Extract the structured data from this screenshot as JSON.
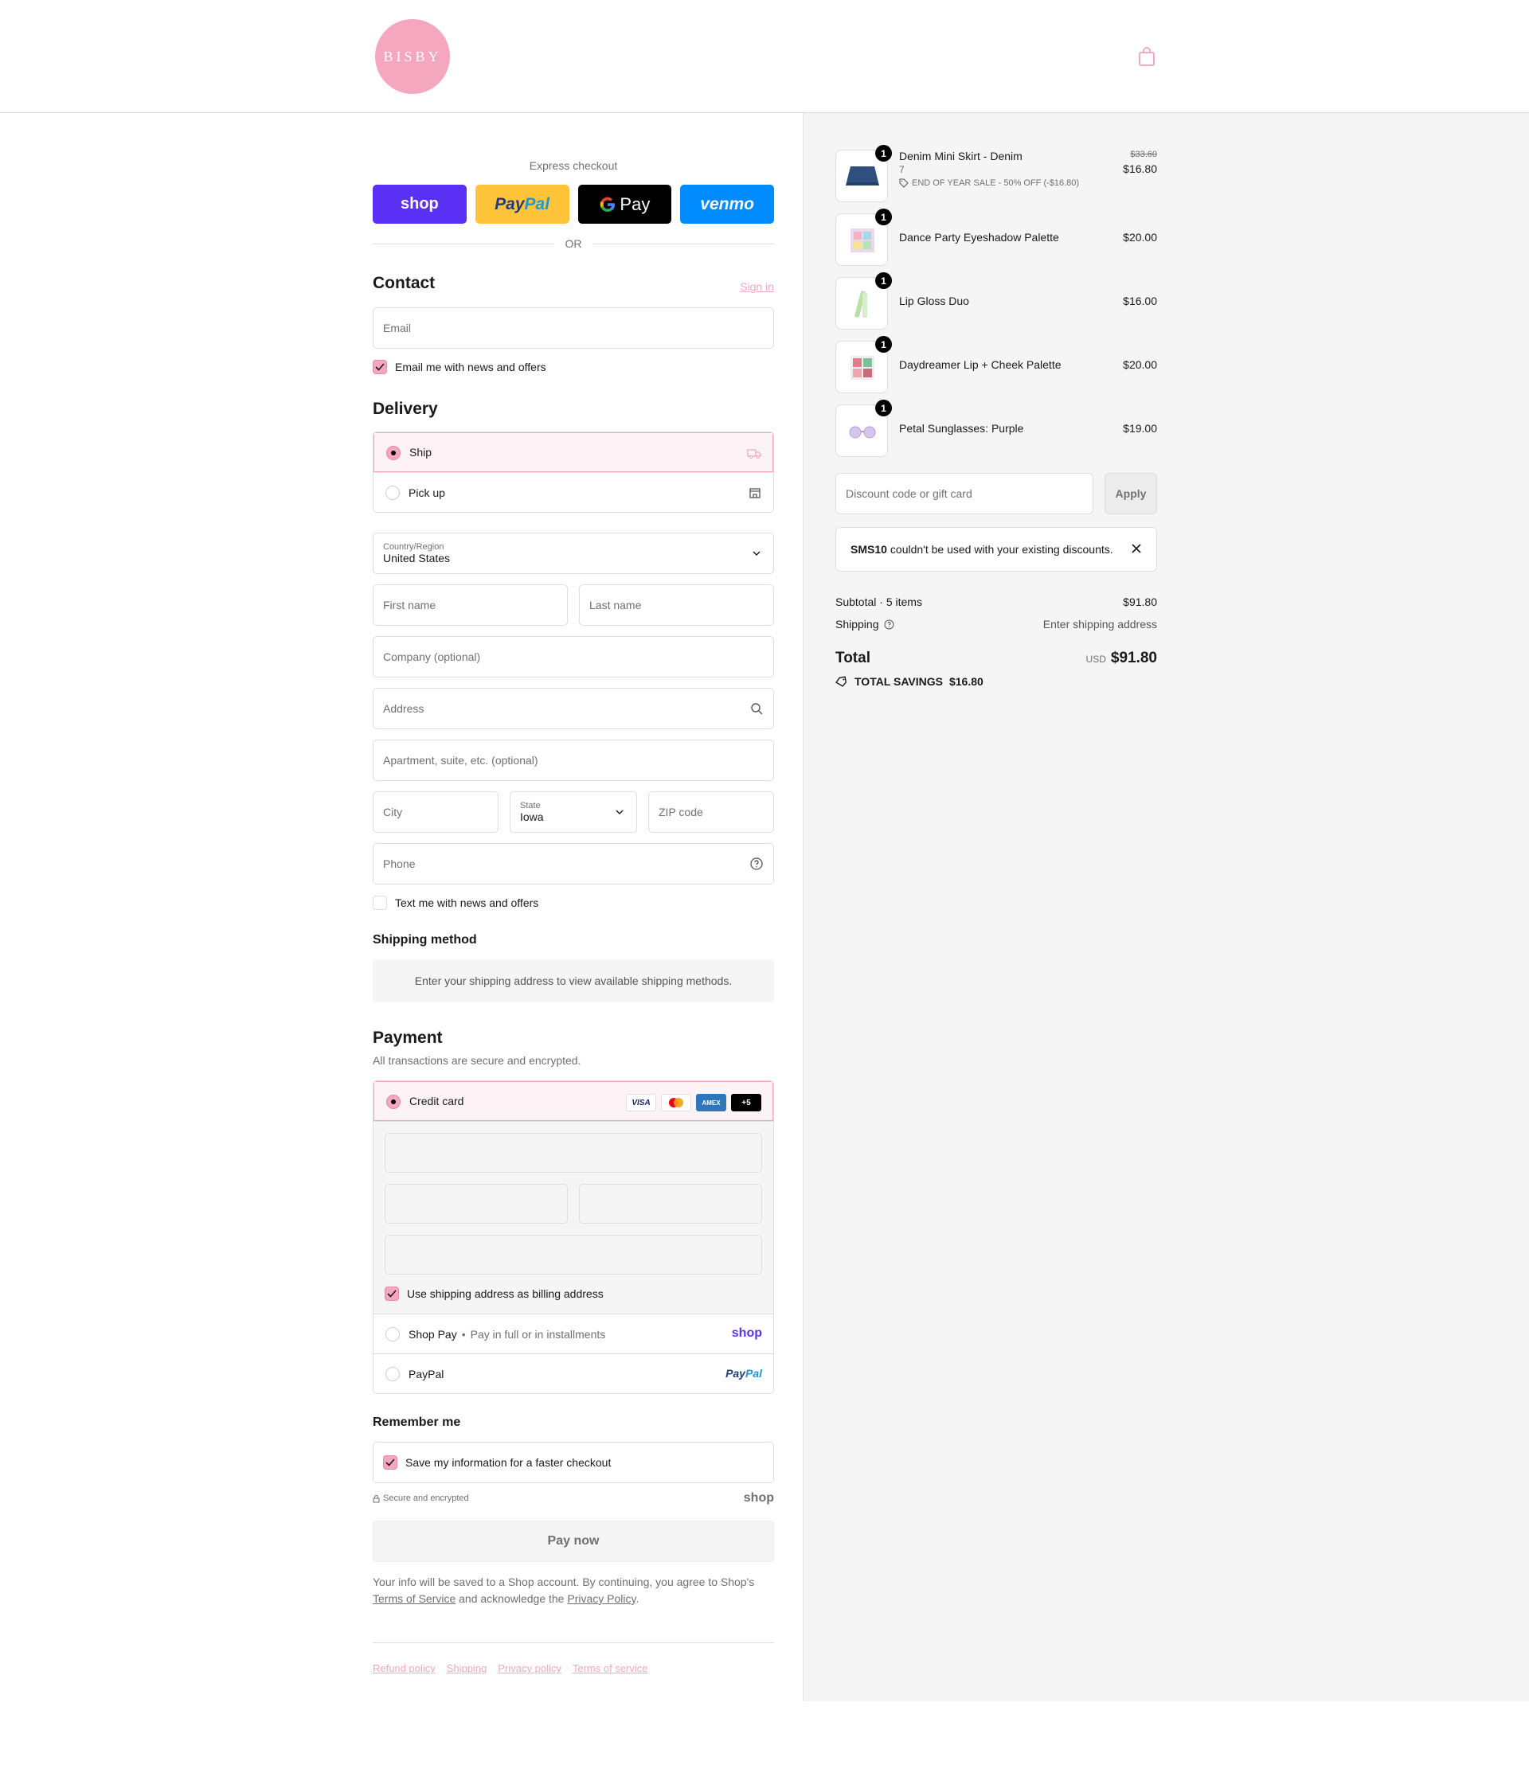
{
  "brand": {
    "logo_text": "BISBY",
    "accent": "#f4a7bf"
  },
  "express": {
    "label": "Express checkout",
    "buttons": {
      "shop": "shop",
      "paypal_a": "Pay",
      "paypal_b": "Pal",
      "gpay": "Pay",
      "venmo": "venmo"
    },
    "or": "OR"
  },
  "contact": {
    "title": "Contact",
    "sign_in": "Sign in",
    "email_placeholder": "Email",
    "news_checkbox": "Email me with news and offers"
  },
  "delivery": {
    "title": "Delivery",
    "options": [
      "Ship",
      "Pick up"
    ],
    "country_label": "Country/Region",
    "country_value": "United States",
    "first_name": "First name",
    "last_name": "Last name",
    "company": "Company (optional)",
    "address": "Address",
    "apartment": "Apartment, suite, etc. (optional)",
    "city": "City",
    "state_label": "State",
    "state_value": "Iowa",
    "zip": "ZIP code",
    "phone": "Phone",
    "text_checkbox": "Text me with news and offers"
  },
  "shipping_method": {
    "title": "Shipping method",
    "message": "Enter your shipping address to view available shipping methods."
  },
  "payment": {
    "title": "Payment",
    "subtitle": "All transactions are secure and encrypted.",
    "credit_card": "Credit card",
    "cards": {
      "visa": "VISA",
      "amex": "AMEX",
      "more": "+5"
    },
    "billing_checkbox": "Use shipping address as billing address",
    "shop_pay": "Shop Pay",
    "shop_pay_note": "Pay in full or in installments",
    "shop_pay_logo": "shop",
    "paypal": "PayPal",
    "paypal_logo_a": "Pay",
    "paypal_logo_b": "Pal"
  },
  "remember": {
    "title": "Remember me",
    "save_checkbox": "Save my information for a faster checkout",
    "secure": "Secure and encrypted",
    "shop_word": "shop"
  },
  "pay_button": "Pay now",
  "legal": {
    "text1": "Your info will be saved to a Shop account. By continuing, you agree to Shop's",
    "terms": "Terms of Service",
    "text2": "and acknowledge the",
    "privacy": "Privacy Policy",
    "end": "."
  },
  "footer_links": [
    "Refund policy",
    "Shipping",
    "Privacy policy",
    "Terms of service"
  ],
  "summary": {
    "items": [
      {
        "name": "Denim Mini Skirt - Denim",
        "variant": "7",
        "discount": "END OF YEAR SALE - 50% OFF (-$16.80)",
        "original": "$33.60",
        "price": "$16.80",
        "qty": "1"
      },
      {
        "name": "Dance Party Eyeshadow Palette",
        "price": "$20.00",
        "qty": "1"
      },
      {
        "name": "Lip Gloss Duo",
        "price": "$16.00",
        "qty": "1"
      },
      {
        "name": "Daydreamer Lip + Cheek Palette",
        "price": "$20.00",
        "qty": "1"
      },
      {
        "name": "Petal Sunglasses: Purple",
        "price": "$19.00",
        "qty": "1"
      }
    ],
    "discount_placeholder": "Discount code or gift card",
    "apply": "Apply",
    "error_code": "SMS10",
    "error_text": "couldn't be used with your existing discounts.",
    "subtotal_label": "Subtotal · 5 items",
    "subtotal_value": "$91.80",
    "shipping_label": "Shipping",
    "shipping_value": "Enter shipping address",
    "total_label": "Total",
    "currency": "USD",
    "total_value": "$91.80",
    "savings_label": "TOTAL SAVINGS",
    "savings_value": "$16.80"
  }
}
